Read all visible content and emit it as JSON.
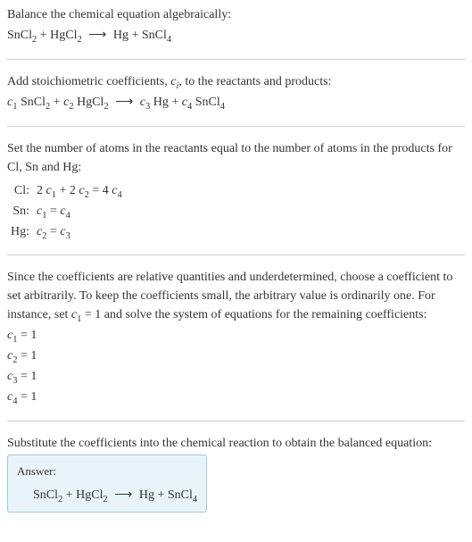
{
  "section1": {
    "title": "Balance the chemical equation algebraically:",
    "eq_l1": "SnCl",
    "eq_l1_sub": "2",
    "eq_plus1": " + ",
    "eq_l2": "HgCl",
    "eq_l2_sub": "2",
    "eq_arrow": "⟶",
    "eq_r1": "Hg",
    "eq_plus2": " + ",
    "eq_r2": "SnCl",
    "eq_r2_sub": "4"
  },
  "section2": {
    "text_a": "Add stoichiometric coefficients, ",
    "ci": "c",
    "ci_sub": "i",
    "text_b": ", to the reactants and products:",
    "c1": "c",
    "c1_sub": "1",
    "sp1": " SnCl",
    "sp1_sub": "2",
    "plus1": " + ",
    "c2": "c",
    "c2_sub": "2",
    "sp2": " HgCl",
    "sp2_sub": "2",
    "arrow": "⟶",
    "c3": "c",
    "c3_sub": "3",
    "sp3": " Hg",
    "plus2": " + ",
    "c4": "c",
    "c4_sub": "4",
    "sp4": " SnCl",
    "sp4_sub": "4"
  },
  "section3": {
    "text": "Set the number of atoms in the reactants equal to the number of atoms in the products for Cl, Sn and Hg:",
    "rows": {
      "r1_label": "Cl:",
      "r1_a": "2 ",
      "r1_c1": "c",
      "r1_c1s": "1",
      "r1_b": " + 2 ",
      "r1_c2": "c",
      "r1_c2s": "2",
      "r1_c": " = 4 ",
      "r1_c4": "c",
      "r1_c4s": "4",
      "r2_label": "Sn:",
      "r2_c1": "c",
      "r2_c1s": "1",
      "r2_eq": " = ",
      "r2_c4": "c",
      "r2_c4s": "4",
      "r3_label": "Hg:",
      "r3_c2": "c",
      "r3_c2s": "2",
      "r3_eq": " = ",
      "r3_c3": "c",
      "r3_c3s": "3"
    }
  },
  "section4": {
    "text_a": "Since the coefficients are relative quantities and underdetermined, choose a coefficient to set arbitrarily. To keep the coefficients small, the arbitrary value is ordinarily one. For instance, set ",
    "c1": "c",
    "c1_sub": "1",
    "text_b": " = 1 and solve the system of equations for the remaining coefficients:",
    "l1_c": "c",
    "l1_s": "1",
    "l1_v": " = 1",
    "l2_c": "c",
    "l2_s": "2",
    "l2_v": " = 1",
    "l3_c": "c",
    "l3_s": "3",
    "l3_v": " = 1",
    "l4_c": "c",
    "l4_s": "4",
    "l4_v": " = 1"
  },
  "section5": {
    "text": "Substitute the coefficients into the chemical reaction to obtain the balanced equation:",
    "answer_label": "Answer:",
    "eq_l1": "SnCl",
    "eq_l1_sub": "2",
    "plus1": " + ",
    "eq_l2": "HgCl",
    "eq_l2_sub": "2",
    "arrow": "⟶",
    "eq_r1": "Hg",
    "plus2": " + ",
    "eq_r2": "SnCl",
    "eq_r2_sub": "4"
  }
}
